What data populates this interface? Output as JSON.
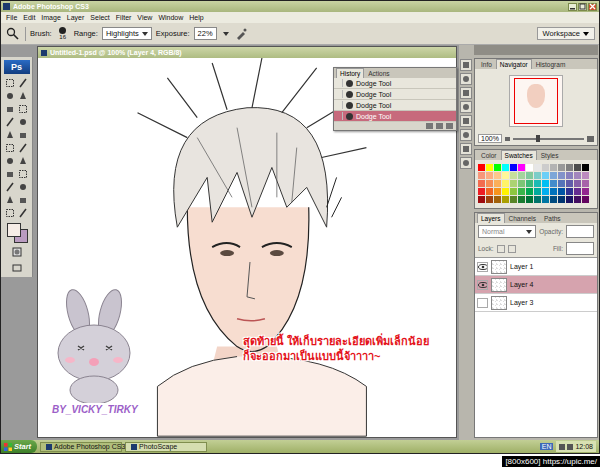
{
  "window": {
    "title": "Adobe Photoshop CS3"
  },
  "menu": [
    "File",
    "Edit",
    "Image",
    "Layer",
    "Select",
    "Filter",
    "View",
    "Window",
    "Help"
  ],
  "options_bar": {
    "brush_label": "Brush:",
    "brush_size": "16",
    "range_label": "Range:",
    "range": "Highlights",
    "exposure_label": "Exposure:",
    "exposure": "22%",
    "workspace": "Workspace"
  },
  "toolbox": {
    "logo": "Ps",
    "foreground": "#f6ede6",
    "background": "#b99bc0"
  },
  "document": {
    "title": "Untitled-1.psd @ 100% (Layer 4, RGB/8)"
  },
  "canvas": {
    "caption": [
      "สุดท้ายนี้ ให้เก็บรายละเอียดเพิ่มเล็กน้อย",
      "ก็จะออกมาเป็นแบบนี้จ้าาาา~"
    ],
    "watermark": "BY_VICKY_TIRKY"
  },
  "history": {
    "tabs": [
      {
        "label": "History",
        "selected": true
      },
      {
        "label": "Actions",
        "selected": false
      }
    ],
    "items": [
      {
        "label": "Dodge Tool",
        "selected": false
      },
      {
        "label": "Dodge Tool",
        "selected": false
      },
      {
        "label": "Dodge Tool",
        "selected": false
      },
      {
        "label": "Dodge Tool",
        "selected": true
      }
    ]
  },
  "navigator": {
    "tabs": [
      {
        "label": "Info",
        "selected": false
      },
      {
        "label": "Navigator",
        "selected": true
      },
      {
        "label": "Histogram",
        "selected": false
      }
    ],
    "zoom": "100%",
    "level": 0.35
  },
  "color_panel": {
    "tabs": [
      {
        "label": "Color",
        "selected": false
      },
      {
        "label": "Swatches",
        "selected": true
      },
      {
        "label": "Styles",
        "selected": false
      }
    ],
    "swatches": [
      "#ff0000",
      "#ffff00",
      "#00ff00",
      "#00ffff",
      "#0000ff",
      "#ff00ff",
      "#ffffff",
      "#e6e6e6",
      "#cccccc",
      "#b3b3b3",
      "#999999",
      "#808080",
      "#4d4d4d",
      "#000000",
      "#f7977a",
      "#fbad82",
      "#fdc68c",
      "#fff799",
      "#c6df9c",
      "#a4d49d",
      "#81ca9d",
      "#7bcdc8",
      "#6ccff7",
      "#7ca6d8",
      "#8293ca",
      "#8881be",
      "#a286bd",
      "#bc8cbf",
      "#f26c4f",
      "#f68e56",
      "#fbaf5a",
      "#fff467",
      "#acd372",
      "#7cc576",
      "#3bb878",
      "#1abbb4",
      "#00bff3",
      "#438ccb",
      "#5574b9",
      "#605ca9",
      "#855fa8",
      "#a763a9",
      "#ed1c24",
      "#f26522",
      "#f7941d",
      "#fff200",
      "#8dc63f",
      "#39b54a",
      "#00a651",
      "#00a99d",
      "#00aeef",
      "#0072bc",
      "#0054a5",
      "#2e3192",
      "#662d91",
      "#92278f",
      "#9e0b0f",
      "#a0410d",
      "#a3620a",
      "#aba000",
      "#598527",
      "#1a7b30",
      "#007236",
      "#00746b",
      "#0076a3",
      "#004b80",
      "#003471",
      "#1b1464",
      "#440e62",
      "#630460"
    ]
  },
  "layers": {
    "tabs": [
      {
        "label": "Layers",
        "selected": true
      },
      {
        "label": "Channels",
        "selected": false
      },
      {
        "label": "Paths",
        "selected": false
      }
    ],
    "blend": "Normal",
    "opacity_label": "Opacity:",
    "lock_label": "Lock:",
    "fill_label": "Fill:",
    "items": [
      {
        "name": "Layer 1",
        "selected": false,
        "visible": true
      },
      {
        "name": "Layer 4",
        "selected": true,
        "visible": true
      },
      {
        "name": "Layer 3",
        "selected": false,
        "visible": false
      }
    ]
  },
  "taskbar": {
    "start": "Start",
    "tasks": [
      {
        "label": "Adobe Photoshop CS3",
        "selected": true
      },
      {
        "label": "PhotoScape",
        "selected": false
      }
    ],
    "lang": "EN",
    "clock": "12:08"
  },
  "footer": "[800x600] https://upic.me/"
}
